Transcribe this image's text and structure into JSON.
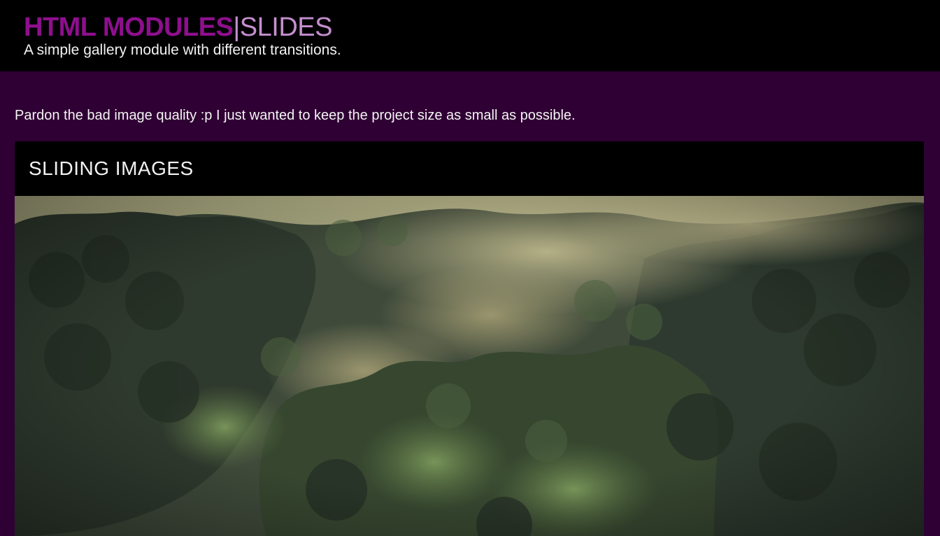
{
  "header": {
    "brand_strong": "HTML MODULES",
    "brand_sep": "|",
    "brand_light": "SLIDES",
    "tagline": "A simple gallery module with different transitions."
  },
  "main": {
    "note": "Pardon the bad image quality :p I just wanted to keep the project size as small as possible."
  },
  "gallery": {
    "title": "SLIDING IMAGES"
  },
  "colors": {
    "page_bg": "#2f0033",
    "header_bg": "#000000",
    "brand_accent": "#8e0f8e",
    "brand_light": "#c58fcf"
  }
}
